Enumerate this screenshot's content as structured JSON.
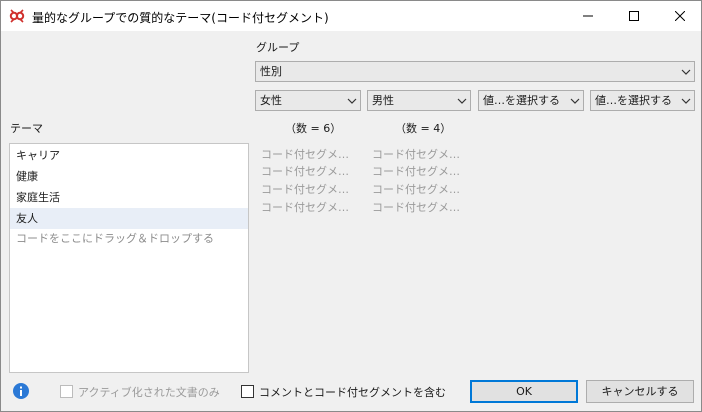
{
  "window": {
    "title": "量的なグループでの質的なテーマ(コード付セグメント)"
  },
  "group": {
    "label": "グループ",
    "selected": "性別",
    "subselects": [
      "女性",
      "男性",
      "値…を選択する",
      "値…を選択する"
    ]
  },
  "themes": {
    "label": "テーマ",
    "items": [
      "キャリア",
      "健康",
      "家庭生活",
      "友人"
    ],
    "selected_index": 3,
    "drop_hint": "コードをここにドラッグ＆ドロップする"
  },
  "columns": [
    {
      "count_label": "（数 = 6）",
      "cells": [
        "コード付セグメ…",
        "コード付セグメ…",
        "コード付セグメ…",
        "コード付セグメ…"
      ]
    },
    {
      "count_label": "（数 = 4）",
      "cells": [
        "コード付セグメ…",
        "コード付セグメ…",
        "コード付セグメ…",
        "コード付セグメ…"
      ]
    }
  ],
  "footer": {
    "active_docs_label": "アクティブ化された文書のみ",
    "active_docs_checked": false,
    "include_comments_label": "コメントとコード付セグメントを含む",
    "include_comments_checked": false,
    "ok_label": "OK",
    "cancel_label": "キャンセルする"
  },
  "icons": {
    "app": "maxqda-app-icon",
    "info": "info-icon",
    "minimize": "minimize-icon",
    "maximize": "maximize-icon",
    "close": "close-icon"
  },
  "colors": {
    "accent": "#0078d7",
    "app_icon": "#d0312d",
    "info_icon": "#2b79d6",
    "selected_row": "#e8eef7",
    "muted_text": "#9a9a9a"
  }
}
